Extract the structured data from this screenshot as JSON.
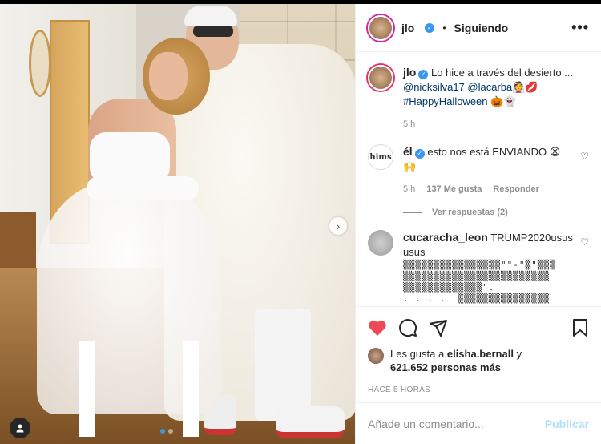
{
  "post": {
    "username": "jlo",
    "follow_status": "Siguiendo",
    "more_label": "•••",
    "separator": "•"
  },
  "caption": {
    "username": "jlo",
    "text": "Lo hice a través del desierto ...",
    "mentions": "@nicksilva17 @lacarba",
    "hashtag": "#HappyHalloween",
    "emoji_line1": "👰💋",
    "emoji_line2": "🎃👻",
    "time": "5 h"
  },
  "comments": [
    {
      "username": "él",
      "text": "esto nos está ENVIANDO 😫",
      "text2": "🙌",
      "time": "5 h",
      "likes": "137 Me gusta",
      "reply_label": "Responder",
      "view_replies": "Ver respuestas (2)",
      "avatar_text": "hims"
    },
    {
      "username": "cucaracha_leon",
      "text": "TRUMP2020usus",
      "text2": "usus",
      "garbled": "▒▒▒▒▒▒▒▒▒▒▒▒▒▒▒▒\"\"-\"▒\"▒▒▒\n▒▒▒▒▒▒▒▒▒▒▒▒▒▒▒▒▒▒▒▒▒▒▒▒\n▒▒▒▒▒▒▒▒▒▒▒▒▒\".\n. . . .  ▒▒▒▒▒▒▒▒▒▒▒▒▒▒▒"
    }
  ],
  "likes": {
    "prefix": "Les gusta a",
    "user": "elisha.bernall",
    "suffix": "y",
    "count": "621.652 personas más"
  },
  "time_ago": "HACE 5 HORAS",
  "composer": {
    "placeholder": "Añade un comentario...",
    "publish_label": "Publicar"
  },
  "icons": {
    "like": "heart-icon",
    "comment": "comment-icon",
    "share": "share-icon",
    "save": "bookmark-icon",
    "next": "chevron-right-icon",
    "tag": "user-tag-icon"
  },
  "colors": {
    "liked_heart": "#ed4956",
    "verified": "#3897f0",
    "mention": "#00376b",
    "publish_disabled": "#b2dffc"
  }
}
